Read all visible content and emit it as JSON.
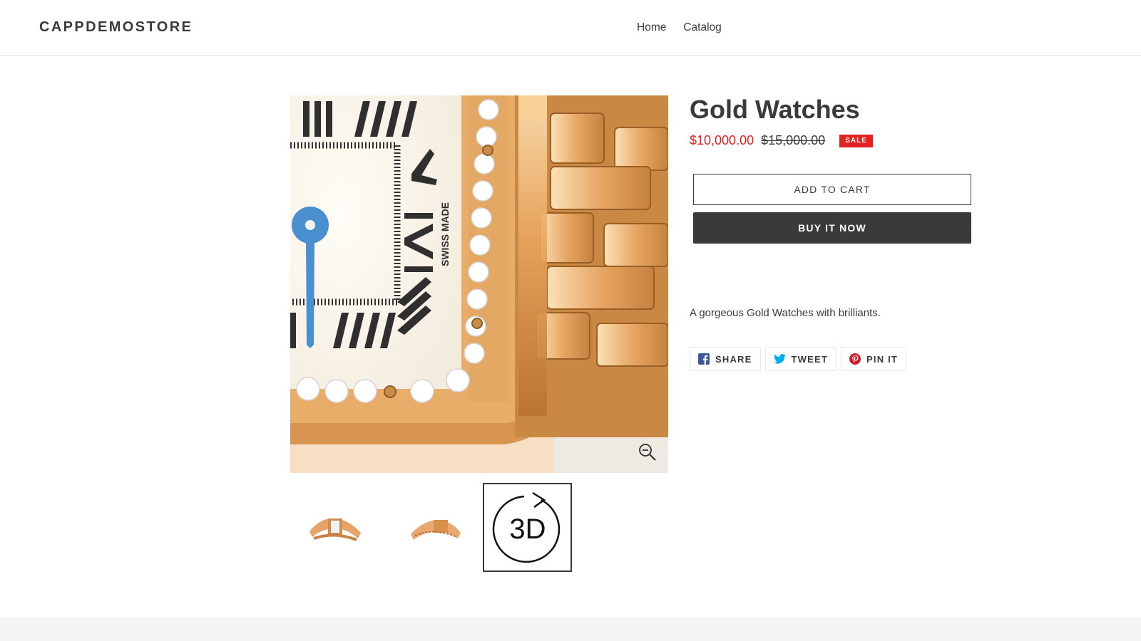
{
  "header": {
    "store_name": "CAPPDEMOSTORE",
    "nav": [
      {
        "label": "Home"
      },
      {
        "label": "Catalog"
      }
    ]
  },
  "product": {
    "title": "Gold Watches",
    "price": "$10,000.00",
    "compare_at_price": "$15,000.00",
    "sale_badge": "SALE",
    "add_to_cart_label": "ADD TO CART",
    "buy_now_label": "BUY IT NOW",
    "description": "A gorgeous Gold Watches with brilliants.",
    "image": {
      "dial_text": "SWISS MADE",
      "zoom_icon": "zoom-out-icon"
    },
    "thumbnails": [
      {
        "icon": "watch-front-thumbnail"
      },
      {
        "icon": "watch-side-thumbnail"
      },
      {
        "label": "3D",
        "icon": "3d-rotate-icon"
      }
    ]
  },
  "social": [
    {
      "label": "SHARE",
      "icon": "facebook-icon",
      "color": "#3b5998"
    },
    {
      "label": "TWEET",
      "icon": "twitter-icon",
      "color": "#00aced"
    },
    {
      "label": "PIN IT",
      "icon": "pinterest-icon",
      "color": "#cb2027"
    }
  ],
  "colors": {
    "text": "#3a3a3a",
    "sale": "#e22120",
    "border": "#e8e8e8",
    "footer": "#f5f5f5"
  }
}
